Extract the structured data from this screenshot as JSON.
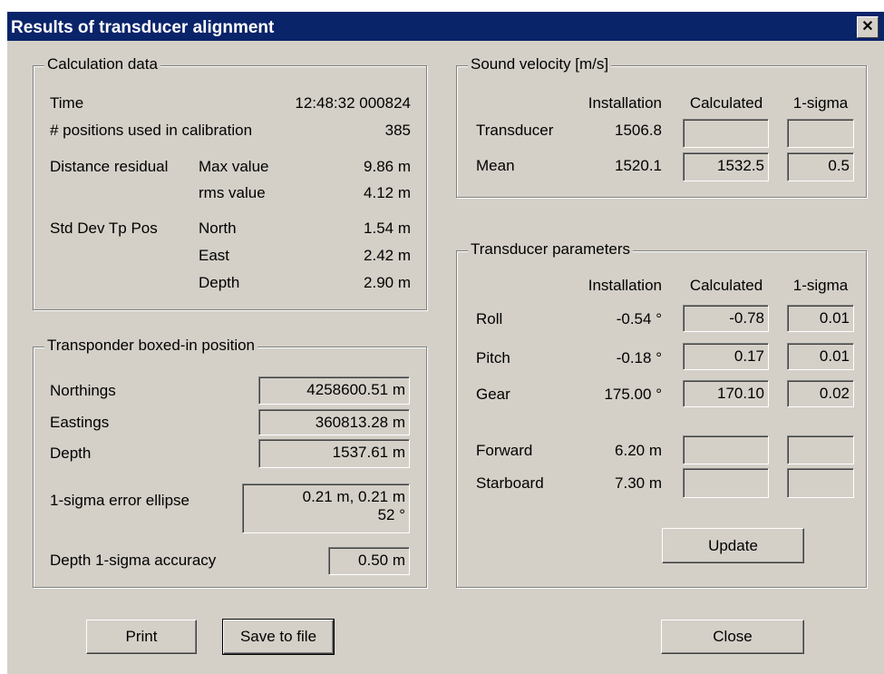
{
  "window": {
    "title": "Results of transducer alignment",
    "close_glyph": "✕"
  },
  "calc": {
    "title": "Calculation data",
    "time_label": "Time",
    "time_value": "12:48:32 000824",
    "positions_label": "# positions used in calibration",
    "positions_value": "385",
    "dist_label": "Distance residual",
    "max_label": "Max value",
    "max_value": "9.86 m",
    "rms_label": "rms value",
    "rms_value": "4.12 m",
    "std_label": "Std Dev Tp Pos",
    "north_label": "North",
    "north_value": "1.54 m",
    "east_label": "East",
    "east_value": "2.42 m",
    "depth_label": "Depth",
    "depth_value": "2.90 m"
  },
  "box": {
    "title": "Transponder boxed-in position",
    "northings_label": "Northings",
    "northings_value": "4258600.51 m",
    "eastings_label": "Eastings",
    "eastings_value": "360813.28 m",
    "depth_label": "Depth",
    "depth_value": "1537.61 m",
    "ellipse_label": "1-sigma error ellipse",
    "ellipse_line1": "0.21 m, 0.21 m",
    "ellipse_line2": "52 °",
    "depth_acc_label": "Depth 1-sigma accuracy",
    "depth_acc_value": "0.50 m"
  },
  "sound": {
    "title": "Sound velocity [m/s]",
    "col_installation": "Installation",
    "col_calculated": "Calculated",
    "col_sigma": "1-sigma",
    "transducer_label": "Transducer",
    "transducer_install": "1506.8",
    "transducer_calc": "",
    "transducer_sigma": "",
    "mean_label": "Mean",
    "mean_install": "1520.1",
    "mean_calc": "1532.5",
    "mean_sigma": "0.5"
  },
  "params": {
    "title": "Transducer parameters",
    "col_installation": "Installation",
    "col_calculated": "Calculated",
    "col_sigma": "1-sigma",
    "roll_label": "Roll",
    "roll_install": "-0.54 °",
    "roll_calc": "-0.78",
    "roll_sigma": "0.01",
    "pitch_label": "Pitch",
    "pitch_install": "-0.18 °",
    "pitch_calc": "0.17",
    "pitch_sigma": "0.01",
    "gear_label": "Gear",
    "gear_install": "175.00 °",
    "gear_calc": "170.10",
    "gear_sigma": "0.02",
    "forward_label": "Forward",
    "forward_install": "6.20 m",
    "forward_calc": "",
    "forward_sigma": "",
    "starboard_label": "Starboard",
    "starboard_install": "7.30 m",
    "starboard_calc": "",
    "starboard_sigma": "",
    "update_label": "Update"
  },
  "buttons": {
    "print": "Print",
    "save": "Save to file",
    "close": "Close"
  }
}
